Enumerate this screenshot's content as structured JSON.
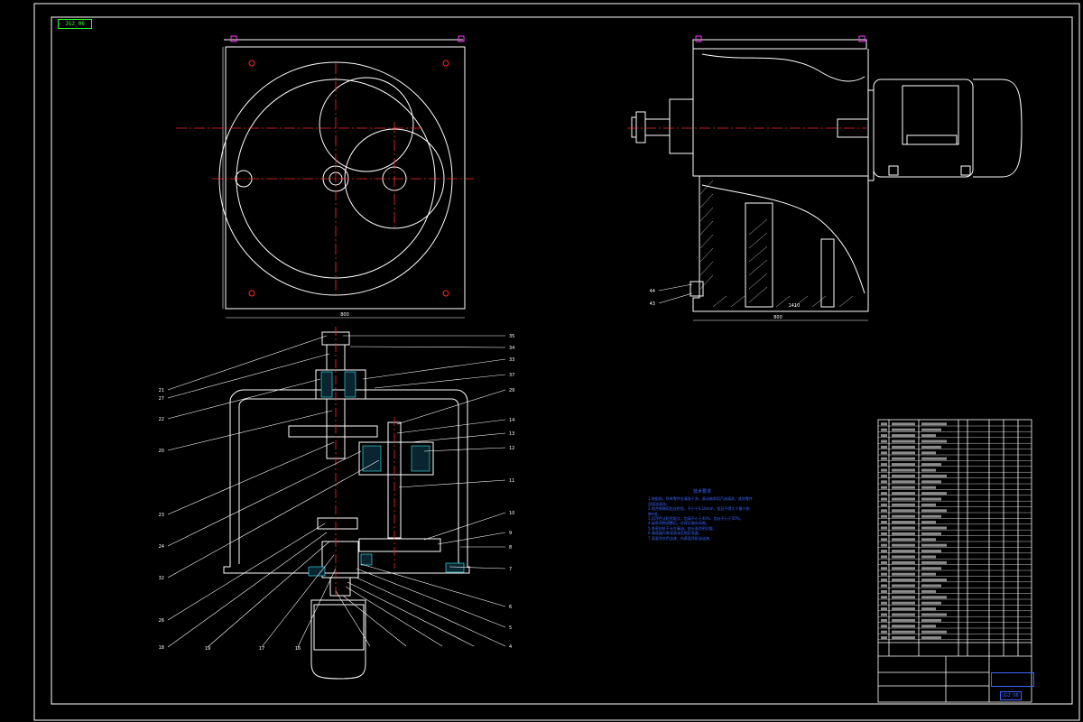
{
  "drawing": {
    "sheet_tag": "JG2_06",
    "title_block_name": "",
    "title_block_code": "JG2_06",
    "tech_notes_title": "技术要求",
    "tech_notes": [
      "1.装配前，所有零件应清洗干净，滚动轴承用汽油清洗，其他零件",
      "用煤油清洗。",
      "2.啮合侧隙用铅丝检验，不小于0.16mm，铅丝不得大于最小侧",
      "隙4倍。",
      "3.用涂色法检验斑点，齿高不小于40%，齿长不小于50%。",
      "4.轴承间隙调整后，应保证轴向间隙。",
      "5.各密封处不允许漏油，剖分面涂密封胶。",
      "6.减速器内装润滑油至规定高度。",
      "7.表面涂灰色油漆，内表面涂耐油油漆。"
    ],
    "callouts_left": [
      "21",
      "27",
      "22",
      "20",
      "23",
      "24",
      "32",
      "26",
      "18",
      "19",
      "17",
      "16"
    ],
    "callouts_right": [
      "35",
      "34",
      "33",
      "37",
      "29",
      "14",
      "13",
      "12",
      "11",
      "10",
      "9",
      "8",
      "7",
      "6",
      "5",
      "4"
    ],
    "callouts_side": [
      "44",
      "43"
    ],
    "dimension_top": "800",
    "dimension_side": "800",
    "dimension_side_inner": "1410"
  },
  "colors": {
    "line": "#ffffff",
    "center": "#ff2a2a",
    "hatch": "#3df0ff",
    "accent": "#3b66ff",
    "green": "#33ff33",
    "magenta": "#ff33ff"
  }
}
